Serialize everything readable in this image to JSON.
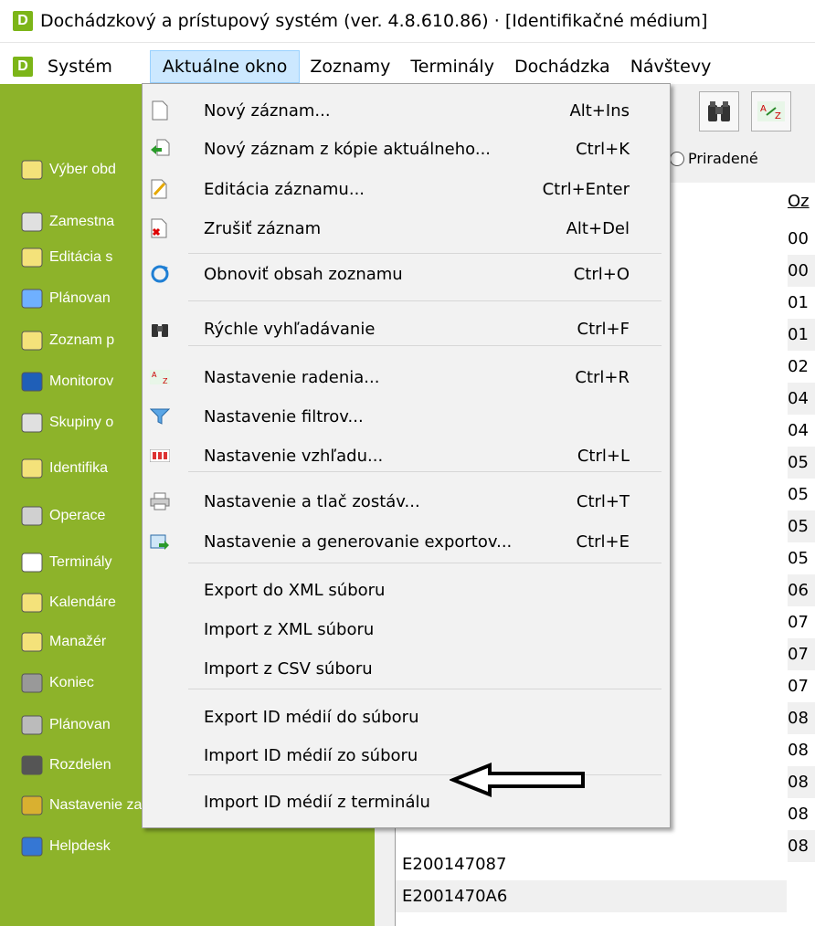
{
  "window": {
    "app_icon_letter": "D",
    "title": "Dochádzkový a prístupový systém (ver. 4.8.610.86) · [Identifikačné médium]"
  },
  "menu": {
    "items": [
      "Systém",
      "Aktuálne okno",
      "Zoznamy",
      "Terminály",
      "Dochádzka",
      "Návštevy"
    ],
    "active": "Aktuálne okno"
  },
  "sidebar": {
    "items": [
      {
        "label": "Výber obd",
        "icon": "calendar-icon"
      },
      {
        "label": "Zamestna",
        "icon": "employee-icon"
      },
      {
        "label": "Editácia s",
        "icon": "edit-icon"
      },
      {
        "label": "Plánovan",
        "icon": "planning-icon"
      },
      {
        "label": "Zoznam p",
        "icon": "list-icon"
      },
      {
        "label": "Monitorov",
        "icon": "monitor-icon"
      },
      {
        "label": "Skupiny o",
        "icon": "groups-icon"
      },
      {
        "label": "Identifika",
        "icon": "identification-icon"
      },
      {
        "label": "Operace",
        "icon": "operations-icon"
      },
      {
        "label": "Terminály",
        "icon": "terminal-icon"
      },
      {
        "label": "Kalendáre",
        "icon": "calendar-icon"
      },
      {
        "label": "Manažér",
        "icon": "manager-icon"
      },
      {
        "label": "Koniec",
        "icon": "exit-icon"
      },
      {
        "label": "Plánovan",
        "icon": "database-icon"
      },
      {
        "label": "Rozdelen",
        "icon": "person-icon"
      },
      {
        "label": "Nastavenie zabezpečenia...",
        "icon": "key-icon"
      },
      {
        "label": "Helpdesk",
        "icon": "info-icon"
      }
    ]
  },
  "toolbar": {
    "radio_label": "Priradené"
  },
  "grid": {
    "header": "Oz",
    "left_rows": [
      "E200147087",
      "E2001470A6"
    ],
    "right_cells": [
      "00",
      "00",
      "01",
      "01",
      "02",
      "04",
      "04",
      "05",
      "05",
      "05",
      "05",
      "06",
      "07",
      "07",
      "07",
      "08",
      "08",
      "08",
      "08",
      "08"
    ]
  },
  "dropdown": {
    "items": [
      {
        "label": "Nový záznam...",
        "shortcut": "Alt+Ins",
        "icon": "new-record-icon"
      },
      {
        "label": "Nový záznam z kópie aktuálneho...",
        "shortcut": "Ctrl+K",
        "icon": "copy-record-icon"
      },
      {
        "label": "Editácia záznamu...",
        "shortcut": "Ctrl+Enter",
        "icon": "edit-record-icon"
      },
      {
        "label": "Zrušiť záznam",
        "shortcut": "Alt+Del",
        "icon": "delete-record-icon"
      },
      {
        "label": "Obnoviť obsah zoznamu",
        "shortcut": "Ctrl+O",
        "icon": "refresh-icon"
      },
      {
        "label": "Rýchle vyhľadávanie",
        "shortcut": "Ctrl+F",
        "icon": "binoculars-icon"
      },
      {
        "label": "Nastavenie radenia...",
        "shortcut": "Ctrl+R",
        "icon": "sort-icon"
      },
      {
        "label": "Nastavenie filtrov...",
        "shortcut": "",
        "icon": "filter-icon"
      },
      {
        "label": "Nastavenie vzhľadu...",
        "shortcut": "Ctrl+L",
        "icon": "columns-icon"
      },
      {
        "label": "Nastavenie a tlač zostáv...",
        "shortcut": "Ctrl+T",
        "icon": "print-icon"
      },
      {
        "label": "Nastavenie a generovanie exportov...",
        "shortcut": "Ctrl+E",
        "icon": "export-icon"
      },
      {
        "label": "Export do XML súboru",
        "shortcut": "",
        "icon": ""
      },
      {
        "label": "Import z XML súboru",
        "shortcut": "",
        "icon": ""
      },
      {
        "label": "Import z CSV súboru",
        "shortcut": "",
        "icon": ""
      },
      {
        "label": "Export ID médií do súboru",
        "shortcut": "",
        "icon": ""
      },
      {
        "label": "Import ID médií zo súboru",
        "shortcut": "",
        "icon": ""
      },
      {
        "label": "Import ID médií z terminálu",
        "shortcut": "",
        "icon": ""
      }
    ]
  },
  "colors": {
    "sidebar": "#8db32a",
    "menu_active": "#cce8ff",
    "app_icon": "#7cb518"
  }
}
